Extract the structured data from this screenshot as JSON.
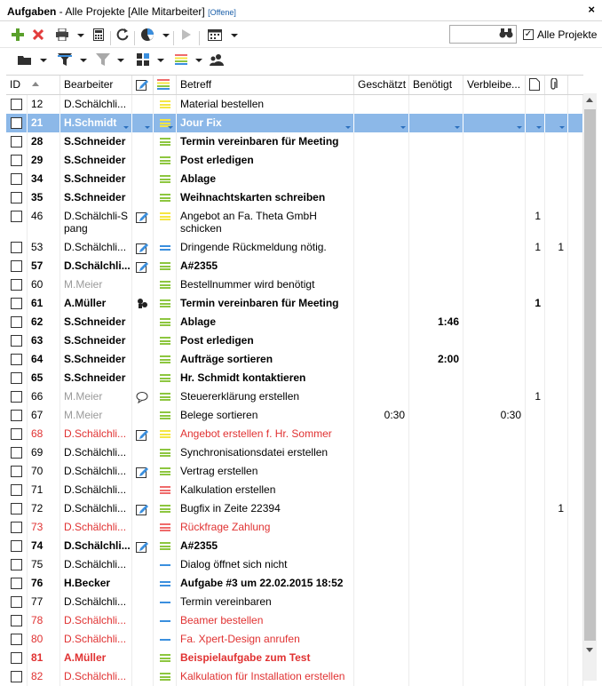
{
  "window": {
    "title_bold": "Aufgaben",
    "title_rest": " - Alle Projekte [Alle Mitarbeiter] ",
    "title_filter": "[Offene]",
    "close": "×"
  },
  "toolbar": {
    "alle_projekte_label": "Alle Projekte",
    "alle_projekte_checked": "✓",
    "search_value": ""
  },
  "columns": {
    "id": "ID",
    "bearbeiter": "Bearbeiter",
    "betreff": "Betreff",
    "geschaetzt": "Geschätzt",
    "benoetigt": "Benötigt",
    "verbleibend": "Verbleibe..."
  },
  "colors": {
    "selected": "#8cb8e8",
    "red_text": "#e03131",
    "gray_text": "#9a9a9a",
    "priority_green": "#8dc63f",
    "priority_yellow": "#f5e642",
    "priority_red": "#ef6b6b",
    "priority_blue": "#3b8fde"
  },
  "rows": [
    {
      "id": "12",
      "user": "D.Schälchli...",
      "subject": "Material bestellen",
      "est": "",
      "req": "",
      "rem": "",
      "docs": "",
      "att": "",
      "edit": false,
      "pri": "yellow",
      "style": "normal"
    },
    {
      "id": "21",
      "user": "H.Schmidt",
      "subject": "Jour Fix",
      "est": "",
      "req": "",
      "rem": "",
      "docs": "",
      "att": "",
      "edit": false,
      "pri": "yellow",
      "style": "selected"
    },
    {
      "id": "28",
      "user": "S.Schneider",
      "subject": "Termin vereinbaren für Meeting",
      "est": "",
      "req": "",
      "rem": "",
      "docs": "",
      "att": "",
      "edit": false,
      "pri": "green",
      "style": "bold"
    },
    {
      "id": "29",
      "user": "S.Schneider",
      "subject": "Post erledigen",
      "est": "",
      "req": "",
      "rem": "",
      "docs": "",
      "att": "",
      "edit": false,
      "pri": "green",
      "style": "bold"
    },
    {
      "id": "34",
      "user": "S.Schneider",
      "subject": "Ablage",
      "est": "",
      "req": "",
      "rem": "",
      "docs": "",
      "att": "",
      "edit": false,
      "pri": "green",
      "style": "bold"
    },
    {
      "id": "35",
      "user": "S.Schneider",
      "subject": "Weihnachtskarten schreiben",
      "est": "",
      "req": "",
      "rem": "",
      "docs": "",
      "att": "",
      "edit": false,
      "pri": "green",
      "style": "bold"
    },
    {
      "id": "46",
      "user": "D.Schälchli-S",
      "user2": "pang",
      "subject": "Angebot an Fa. Theta GmbH",
      "subject2": "schicken",
      "est": "",
      "req": "",
      "rem": "",
      "docs": "1",
      "att": "",
      "edit": true,
      "pri": "yellow",
      "style": "normal",
      "tall": true
    },
    {
      "id": "53",
      "user": "D.Schälchli...",
      "subject": "Dringende Rückmeldung nötig.",
      "est": "",
      "req": "",
      "rem": "",
      "docs": "1",
      "att": "1",
      "edit": true,
      "pri": "blue",
      "style": "normal"
    },
    {
      "id": "57",
      "user": "D.Schälchli...",
      "subject": "A#2355",
      "est": "",
      "req": "",
      "rem": "",
      "docs": "",
      "att": "",
      "edit": true,
      "pri": "green",
      "style": "bold"
    },
    {
      "id": "60",
      "user": "M.Meier",
      "subject": "Bestellnummer wird benötigt",
      "est": "",
      "req": "",
      "rem": "",
      "docs": "",
      "att": "",
      "edit": false,
      "pri": "green",
      "style": "grayuser"
    },
    {
      "id": "61",
      "user": "A.Müller",
      "subject": "Termin vereinbaren für Meeting",
      "est": "",
      "req": "",
      "rem": "",
      "docs": "1",
      "att": "",
      "edit": false,
      "icon": "people",
      "pri": "green",
      "style": "bold"
    },
    {
      "id": "62",
      "user": "S.Schneider",
      "subject": "Ablage",
      "est": "",
      "req": "1:46",
      "rem": "",
      "docs": "",
      "att": "",
      "edit": false,
      "pri": "green",
      "style": "bold"
    },
    {
      "id": "63",
      "user": "S.Schneider",
      "subject": "Post erledigen",
      "est": "",
      "req": "",
      "rem": "",
      "docs": "",
      "att": "",
      "edit": false,
      "pri": "green",
      "style": "bold"
    },
    {
      "id": "64",
      "user": "S.Schneider",
      "subject": "Aufträge sortieren",
      "est": "",
      "req": "2:00",
      "rem": "",
      "docs": "",
      "att": "",
      "edit": false,
      "pri": "green",
      "style": "bold"
    },
    {
      "id": "65",
      "user": "S.Schneider",
      "subject": "Hr. Schmidt kontaktieren",
      "est": "",
      "req": "",
      "rem": "",
      "docs": "",
      "att": "",
      "edit": false,
      "pri": "green",
      "style": "bold"
    },
    {
      "id": "66",
      "user": "M.Meier",
      "subject": "Steuererklärung erstellen",
      "est": "",
      "req": "",
      "rem": "",
      "docs": "1",
      "att": "",
      "edit": false,
      "icon": "bubble",
      "pri": "green",
      "style": "grayuser"
    },
    {
      "id": "67",
      "user": "M.Meier",
      "subject": "Belege sortieren",
      "est": "0:30",
      "req": "",
      "rem": "0:30",
      "docs": "",
      "att": "",
      "edit": false,
      "pri": "green",
      "style": "grayuser"
    },
    {
      "id": "68",
      "user": "D.Schälchli...",
      "subject": "Angebot erstellen f. Hr. Sommer",
      "est": "",
      "req": "",
      "rem": "",
      "docs": "",
      "att": "",
      "edit": true,
      "pri": "yellow",
      "style": "red"
    },
    {
      "id": "69",
      "user": "D.Schälchli...",
      "subject": "Synchronisationsdatei erstellen",
      "est": "",
      "req": "",
      "rem": "",
      "docs": "",
      "att": "",
      "edit": false,
      "pri": "green",
      "style": "normal"
    },
    {
      "id": "70",
      "user": "D.Schälchli...",
      "subject": "Vertrag erstellen",
      "est": "",
      "req": "",
      "rem": "",
      "docs": "",
      "att": "",
      "edit": true,
      "pri": "green",
      "style": "normal"
    },
    {
      "id": "71",
      "user": "D.Schälchli...",
      "subject": "Kalkulation erstellen",
      "est": "",
      "req": "",
      "rem": "",
      "docs": "",
      "att": "",
      "edit": false,
      "pri": "red",
      "style": "normal"
    },
    {
      "id": "72",
      "user": "D.Schälchli...",
      "subject": "Bugfix in Zeite 22394",
      "est": "",
      "req": "",
      "rem": "",
      "docs": "",
      "att": "1",
      "edit": true,
      "pri": "green",
      "style": "normal"
    },
    {
      "id": "73",
      "user": "D.Schälchli...",
      "subject": "Rückfrage Zahlung",
      "est": "",
      "req": "",
      "rem": "",
      "docs": "",
      "att": "",
      "edit": false,
      "pri": "red",
      "style": "red"
    },
    {
      "id": "74",
      "user": "D.Schälchli...",
      "subject": "A#2355",
      "est": "",
      "req": "",
      "rem": "",
      "docs": "",
      "att": "",
      "edit": true,
      "pri": "green",
      "style": "bold"
    },
    {
      "id": "75",
      "user": "D.Schälchli...",
      "subject": "Dialog öffnet sich nicht",
      "est": "",
      "req": "",
      "rem": "",
      "docs": "",
      "att": "",
      "edit": false,
      "pri": "blueone",
      "style": "normal"
    },
    {
      "id": "76",
      "user": "H.Becker",
      "subject": "Aufgabe #3 um 22.02.2015 18:52",
      "est": "",
      "req": "",
      "rem": "",
      "docs": "",
      "att": "",
      "edit": false,
      "pri": "blue",
      "style": "bold"
    },
    {
      "id": "77",
      "user": "D.Schälchli...",
      "subject": "Termin vereinbaren",
      "est": "",
      "req": "",
      "rem": "",
      "docs": "",
      "att": "",
      "edit": false,
      "pri": "blueone",
      "style": "normal"
    },
    {
      "id": "78",
      "user": "D.Schälchli...",
      "subject": "Beamer bestellen",
      "est": "",
      "req": "",
      "rem": "",
      "docs": "",
      "att": "",
      "edit": false,
      "pri": "blueone",
      "style": "red"
    },
    {
      "id": "80",
      "user": "D.Schälchli...",
      "subject": "Fa. Xpert-Design anrufen",
      "est": "",
      "req": "",
      "rem": "",
      "docs": "",
      "att": "",
      "edit": false,
      "pri": "blueone",
      "style": "red"
    },
    {
      "id": "81",
      "user": "A.Müller",
      "subject": "Beispielaufgabe zum Test",
      "est": "",
      "req": "",
      "rem": "",
      "docs": "",
      "att": "",
      "edit": false,
      "pri": "green",
      "style": "boldred"
    },
    {
      "id": "82",
      "user": "D.Schälchli...",
      "subject": "Kalkulation für Installation erstellen",
      "est": "",
      "req": "",
      "rem": "",
      "docs": "",
      "att": "",
      "edit": false,
      "pri": "green",
      "style": "red"
    }
  ]
}
